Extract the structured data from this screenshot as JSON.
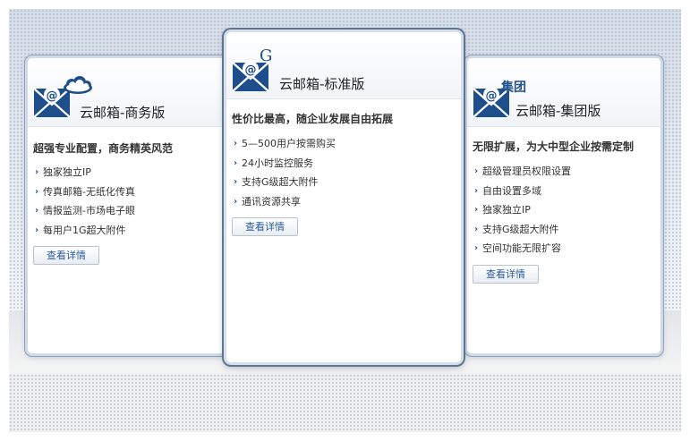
{
  "plans": [
    {
      "title": "云邮箱-商务版",
      "badge": "",
      "tagline": "超强专业配置，商务精英风范",
      "features": [
        "独家独立IP",
        "传真邮箱-无纸化传真",
        "情报监测-市场电子眼",
        "每用户1G超大附件"
      ],
      "button": "查看详情"
    },
    {
      "title": "云邮箱-标准版",
      "badge": "G",
      "tagline": "性价比最高，随企业发展自由拓展",
      "features": [
        "5—500用户按需购买",
        "24小时监控服务",
        "支持G级超大附件",
        "通讯资源共享"
      ],
      "button": "查看详情"
    },
    {
      "title": "云邮箱-集团版",
      "badge": "集团",
      "tagline": "无限扩展，为大中型企业按需定制",
      "features": [
        "超级管理员权限设置",
        "自由设置多域",
        "独家独立IP",
        "支持G级超大附件",
        "空间功能无限扩容"
      ],
      "button": "查看详情"
    }
  ],
  "icons": {
    "envelope": "envelope-at-icon",
    "cloud": "cloud-icon",
    "bullet": "›"
  },
  "colors": {
    "accent": "#1f4e8c",
    "button_text": "#2b5c9a",
    "card_border": "#8fa3bd"
  }
}
